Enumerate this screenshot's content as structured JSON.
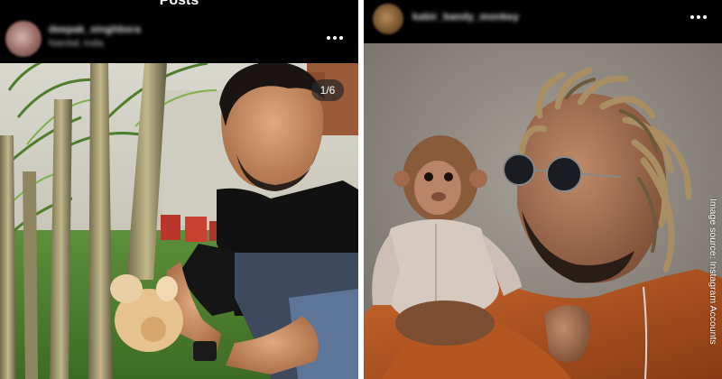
{
  "screen_title": "Posts",
  "left_post": {
    "username": "deepak_singhbora",
    "subtext": "Nainital, India",
    "media_counter": "1/6"
  },
  "right_post": {
    "username": "kabir_bandy_monkey"
  },
  "image_credit": "Image source: Instagram Accounts",
  "icons": {
    "more_options": "more-horizontal-icon"
  }
}
